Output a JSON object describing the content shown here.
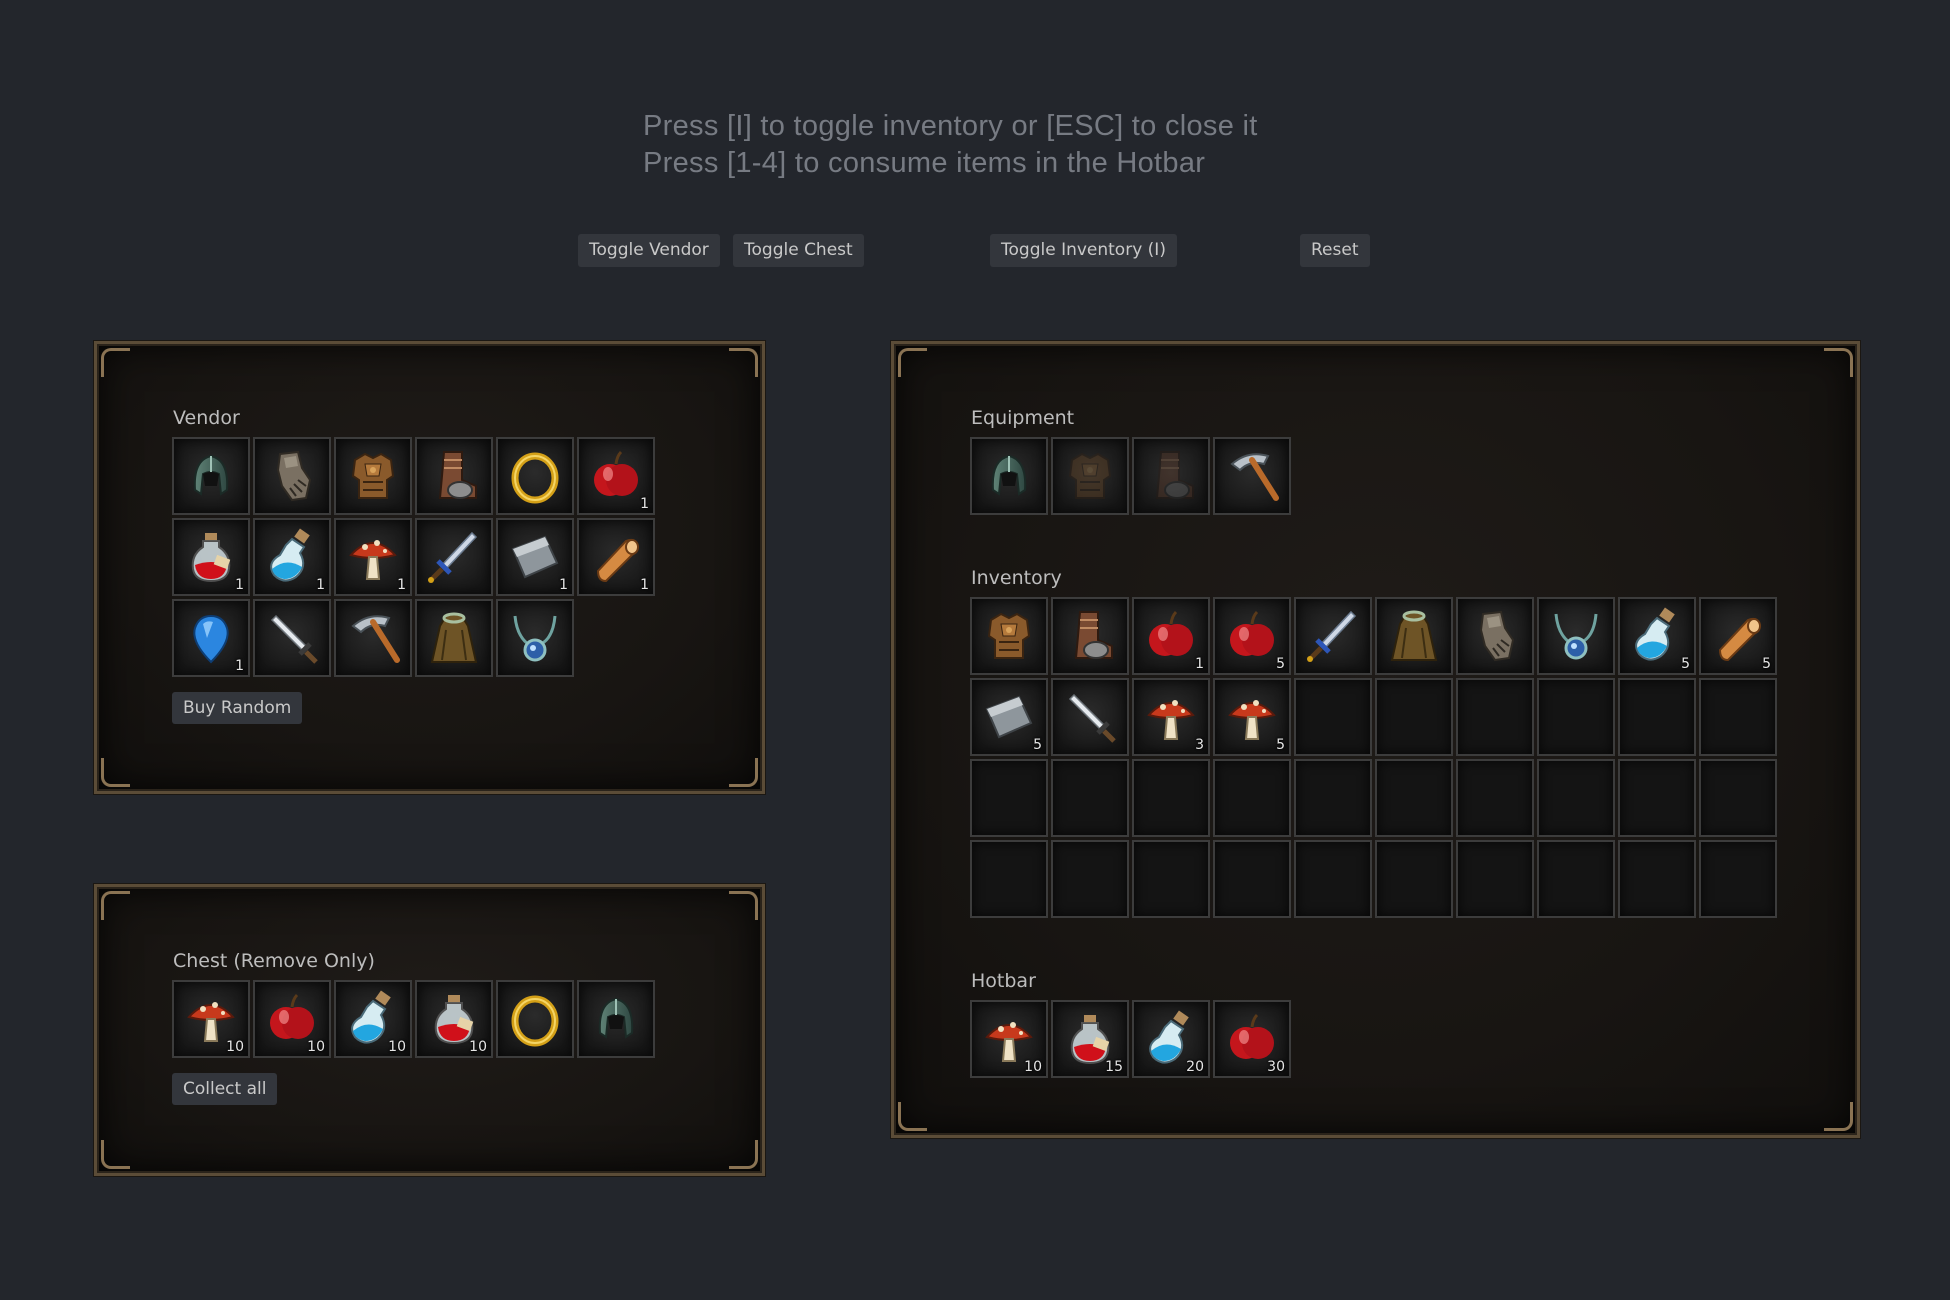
{
  "instructions": {
    "line1": "Press [I] to toggle inventory or [ESC] to close it",
    "line2": "Press [1-4] to consume items in the Hotbar"
  },
  "controls": {
    "toggle_vendor": "Toggle Vendor",
    "toggle_chest": "Toggle Chest",
    "toggle_inventory": "Toggle Inventory (I)",
    "reset": "Reset"
  },
  "vendor": {
    "title": "Vendor",
    "button": "Buy Random",
    "items": [
      {
        "icon": "helmet-icon",
        "qty": ""
      },
      {
        "icon": "gauntlet-icon",
        "qty": ""
      },
      {
        "icon": "chest-armor-icon",
        "qty": ""
      },
      {
        "icon": "boots-icon",
        "qty": ""
      },
      {
        "icon": "ring-icon",
        "qty": ""
      },
      {
        "icon": "apple-icon",
        "qty": "1"
      },
      {
        "icon": "red-potion-icon",
        "qty": "1"
      },
      {
        "icon": "blue-potion-icon",
        "qty": "1"
      },
      {
        "icon": "mushroom-icon",
        "qty": "1"
      },
      {
        "icon": "sword-icon",
        "qty": ""
      },
      {
        "icon": "iron-ingot-icon",
        "qty": "1"
      },
      {
        "icon": "wood-log-icon",
        "qty": "1"
      },
      {
        "icon": "gem-icon",
        "qty": "1"
      },
      {
        "icon": "dagger-icon",
        "qty": ""
      },
      {
        "icon": "pickaxe-icon",
        "qty": ""
      },
      {
        "icon": "cloak-icon",
        "qty": ""
      },
      {
        "icon": "amulet-icon",
        "qty": ""
      }
    ]
  },
  "chest": {
    "title": "Chest (Remove Only)",
    "button": "Collect all",
    "items": [
      {
        "icon": "mushroom-icon",
        "qty": "10"
      },
      {
        "icon": "apple-icon",
        "qty": "10"
      },
      {
        "icon": "blue-potion-icon",
        "qty": "10"
      },
      {
        "icon": "red-potion-icon",
        "qty": "10"
      },
      {
        "icon": "ring-icon",
        "qty": ""
      },
      {
        "icon": "helmet-icon",
        "qty": ""
      }
    ]
  },
  "equipment": {
    "title": "Equipment",
    "items": [
      {
        "icon": "helmet-icon",
        "qty": ""
      },
      {
        "icon": "chest-armor-icon",
        "qty": "",
        "ghost": true
      },
      {
        "icon": "boots-icon",
        "qty": "",
        "ghost": true
      },
      {
        "icon": "pickaxe-icon",
        "qty": ""
      }
    ]
  },
  "inventory": {
    "title": "Inventory",
    "items": [
      {
        "icon": "chest-armor-icon",
        "qty": ""
      },
      {
        "icon": "boots-icon",
        "qty": ""
      },
      {
        "icon": "apple-icon",
        "qty": "1"
      },
      {
        "icon": "apple-icon",
        "qty": "5"
      },
      {
        "icon": "sword-icon",
        "qty": ""
      },
      {
        "icon": "cloak-icon",
        "qty": ""
      },
      {
        "icon": "gauntlet-icon",
        "qty": ""
      },
      {
        "icon": "amulet-icon",
        "qty": ""
      },
      {
        "icon": "blue-potion-icon",
        "qty": "5"
      },
      {
        "icon": "wood-log-icon",
        "qty": "5"
      },
      {
        "icon": "iron-ingot-icon",
        "qty": "5"
      },
      {
        "icon": "dagger-icon",
        "qty": ""
      },
      {
        "icon": "mushroom-icon",
        "qty": "3"
      },
      {
        "icon": "mushroom-icon",
        "qty": "5"
      },
      null,
      null,
      null,
      null,
      null,
      null,
      null,
      null,
      null,
      null,
      null,
      null,
      null,
      null,
      null,
      null,
      null,
      null,
      null,
      null,
      null,
      null,
      null,
      null,
      null,
      null
    ]
  },
  "hotbar": {
    "title": "Hotbar",
    "items": [
      {
        "icon": "mushroom-icon",
        "qty": "10"
      },
      {
        "icon": "red-potion-icon",
        "qty": "15"
      },
      {
        "icon": "blue-potion-icon",
        "qty": "20"
      },
      {
        "icon": "apple-icon",
        "qty": "30"
      }
    ]
  }
}
